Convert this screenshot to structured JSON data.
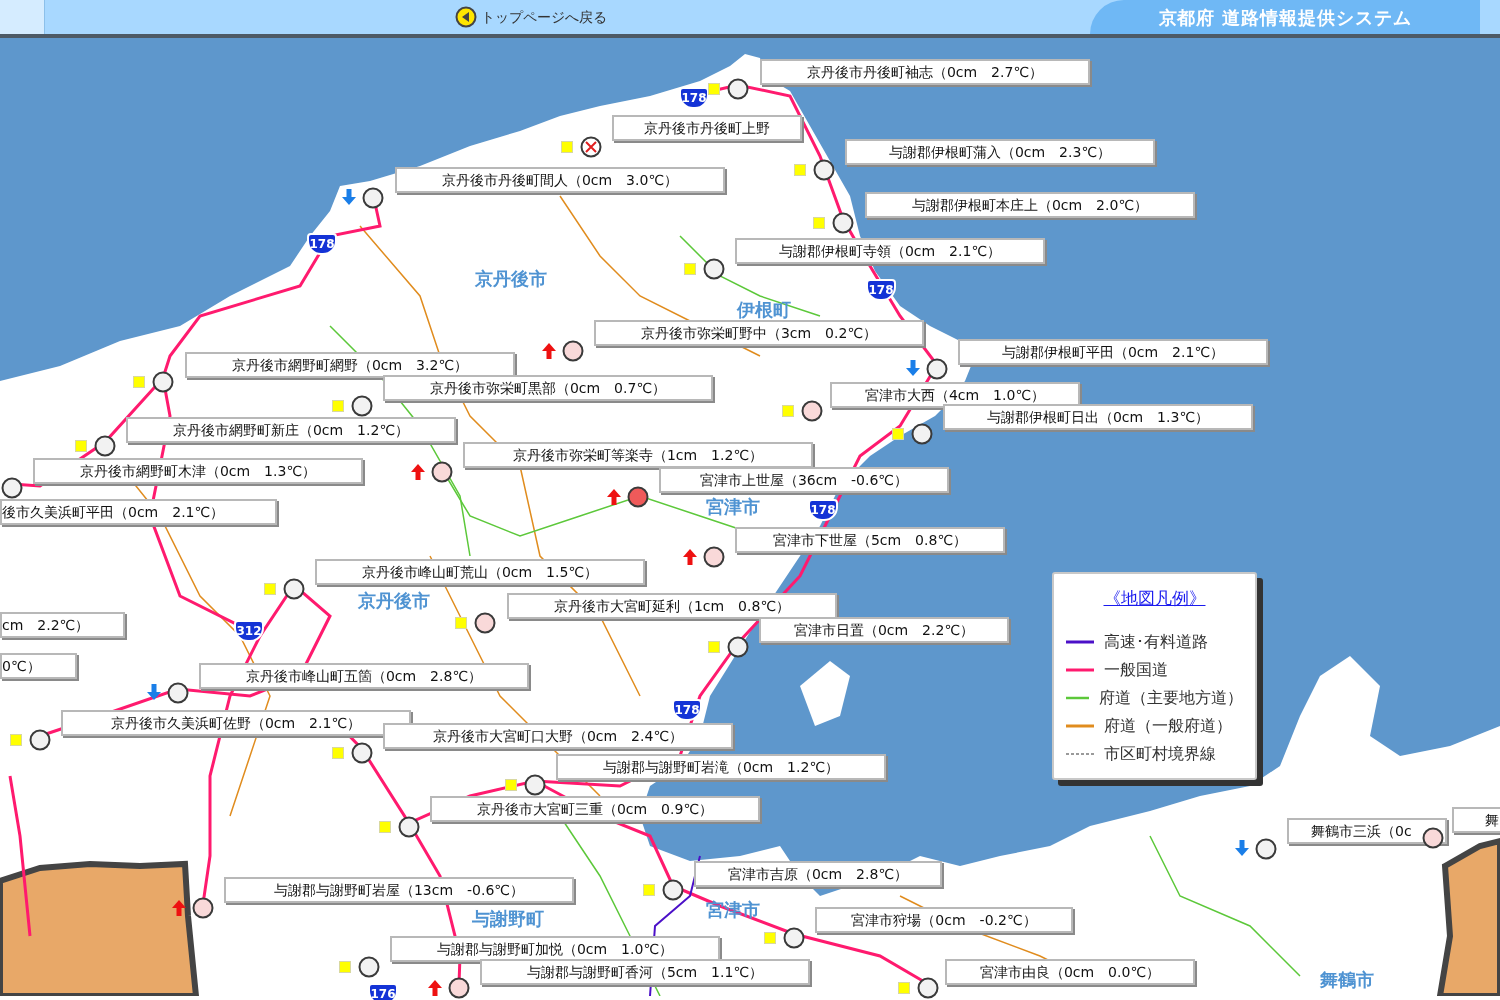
{
  "header": {
    "back_link": "トップページへ戻る",
    "title": "京都府 道路情報提供システム"
  },
  "stations": [
    {
      "name": "京丹後市丹後町袖志（0cm　2.7℃）",
      "kind": "normal",
      "rising": false,
      "falling": false,
      "camera": true
    },
    {
      "name": "京丹後市丹後町上野",
      "kind": "closed",
      "rising": false,
      "falling": false,
      "camera": true
    },
    {
      "name": "与謝郡伊根町蒲入（0cm　2.3℃）",
      "kind": "normal",
      "rising": false,
      "falling": false,
      "camera": true
    },
    {
      "name": "与謝郡伊根町本庄上（0cm　2.0℃）",
      "kind": "normal",
      "rising": false,
      "falling": false,
      "camera": true
    },
    {
      "name": "京丹後市丹後町間人（0cm　3.0℃）",
      "kind": "normal",
      "rising": false,
      "falling": true,
      "camera": false
    },
    {
      "name": "与謝郡伊根町寺領（0cm　2.1℃）",
      "kind": "normal",
      "rising": false,
      "falling": false,
      "camera": true
    },
    {
      "name": "京丹後市弥栄町野中（3cm　0.2℃）",
      "kind": "snow",
      "rising": true,
      "falling": false,
      "camera": false
    },
    {
      "name": "与謝郡伊根町平田（0cm　2.1℃）",
      "kind": "normal",
      "rising": false,
      "falling": true,
      "camera": false
    },
    {
      "name": "京丹後市網野町網野（0cm　3.2℃）",
      "kind": "normal",
      "rising": false,
      "falling": false,
      "camera": true
    },
    {
      "name": "京丹後市弥栄町黒部（0cm　0.7℃）",
      "kind": "normal",
      "rising": false,
      "falling": false,
      "camera": true
    },
    {
      "name": "宮津市大西（4cm　1.0℃）",
      "kind": "snow",
      "rising": false,
      "falling": false,
      "camera": true
    },
    {
      "name": "与謝郡伊根町日出（0cm　1.3℃）",
      "kind": "normal",
      "rising": false,
      "falling": false,
      "camera": true
    },
    {
      "name": "京丹後市網野町新庄（0cm　1.2℃）",
      "kind": "normal",
      "rising": false,
      "falling": false,
      "camera": true
    },
    {
      "name": "京丹後市弥栄町等楽寺（1cm　1.2℃）",
      "kind": "snow",
      "rising": true,
      "falling": false,
      "camera": false
    },
    {
      "name": "京丹後市網野町木津（0cm　1.3℃）",
      "kind": "normal",
      "rising": false,
      "falling": false,
      "camera": false
    },
    {
      "name": "宮津市上世屋（36cm　-0.6℃）",
      "kind": "alert",
      "rising": true,
      "falling": false,
      "camera": false
    },
    {
      "name": "後市久美浜町平田（0cm　2.1℃）"
    },
    {
      "name": "宮津市下世屋（5cm　0.8℃）",
      "kind": "snow",
      "rising": true,
      "falling": false,
      "camera": false
    },
    {
      "name": "京丹後市峰山町荒山（0cm　1.5℃）",
      "kind": "normal",
      "rising": false,
      "falling": false,
      "camera": true
    },
    {
      "name": "cm　2.2℃）"
    },
    {
      "name": "京丹後市大宮町延利（1cm　0.8℃）",
      "kind": "snow",
      "rising": false,
      "falling": false,
      "camera": true
    },
    {
      "name": "宮津市日置（0cm　2.2℃）",
      "kind": "normal",
      "rising": false,
      "falling": false,
      "camera": true
    },
    {
      "name": "0℃）"
    },
    {
      "name": "京丹後市峰山町五箇（0cm　2.8℃）",
      "kind": "normal",
      "rising": false,
      "falling": true,
      "camera": false
    },
    {
      "name": "京丹後市久美浜町佐野（0cm　2.1℃）",
      "kind": "normal",
      "rising": false,
      "falling": false,
      "camera": true
    },
    {
      "name": "京丹後市大宮町口大野（0cm　2.4℃）",
      "kind": "normal",
      "rising": false,
      "falling": false,
      "camera": true
    },
    {
      "name": "与謝郡与謝野町岩滝（0cm　1.2℃）",
      "kind": "normal",
      "rising": false,
      "falling": false,
      "camera": true
    },
    {
      "name": "京丹後市大宮町三重（0cm　0.9℃）",
      "kind": "normal",
      "rising": false,
      "falling": false,
      "camera": true
    },
    {
      "name": "舞鶴市三浜（0c",
      "kind": "normal",
      "rising": false,
      "falling": true,
      "camera": false
    },
    {
      "name": "舞",
      "kind": "snow",
      "rising": false,
      "falling": false,
      "camera": false
    },
    {
      "name": "宮津市吉原（0cm　2.8℃）",
      "kind": "normal",
      "rising": false,
      "falling": false,
      "camera": true
    },
    {
      "name": "与謝郡与謝野町岩屋（13cm　-0.6℃）",
      "kind": "snow",
      "rising": true,
      "falling": false,
      "camera": false
    },
    {
      "name": "宮津市狩場（0cm　-0.2℃）",
      "kind": "normal",
      "rising": false,
      "falling": false,
      "camera": true
    },
    {
      "name": "与謝郡与謝野町加悦（0cm　1.0℃）",
      "kind": "normal",
      "rising": false,
      "falling": false,
      "camera": true
    },
    {
      "name": "与謝郡与謝野町香河（5cm　1.1℃）",
      "kind": "snow",
      "rising": true,
      "falling": false,
      "camera": false
    },
    {
      "name": "宮津市由良（0cm　0.0℃）",
      "kind": "normal",
      "rising": false,
      "falling": false,
      "camera": true
    }
  ],
  "place_names": [
    "京丹後市",
    "伊根町",
    "宮津市",
    "京丹後市",
    "与謝野町",
    "宮津市",
    "舞鶴市"
  ],
  "route_shields": [
    "178",
    "178",
    "178",
    "178",
    "178",
    "312",
    "176"
  ],
  "legend": {
    "title": "《地図凡例》",
    "items": [
      {
        "label": "高速･有料道路",
        "color": "#4b10c8",
        "kind": "solid"
      },
      {
        "label": "一般国道",
        "color": "#ff1a6e",
        "kind": "solid"
      },
      {
        "label": "府道（主要地方道）",
        "color": "#5cc83a",
        "kind": "solid"
      },
      {
        "label": "府道（一般府道）",
        "color": "#e08c1e",
        "kind": "solid"
      },
      {
        "label": "市区町村境界線",
        "color": "#9a9a9a",
        "kind": "dashed"
      }
    ]
  }
}
